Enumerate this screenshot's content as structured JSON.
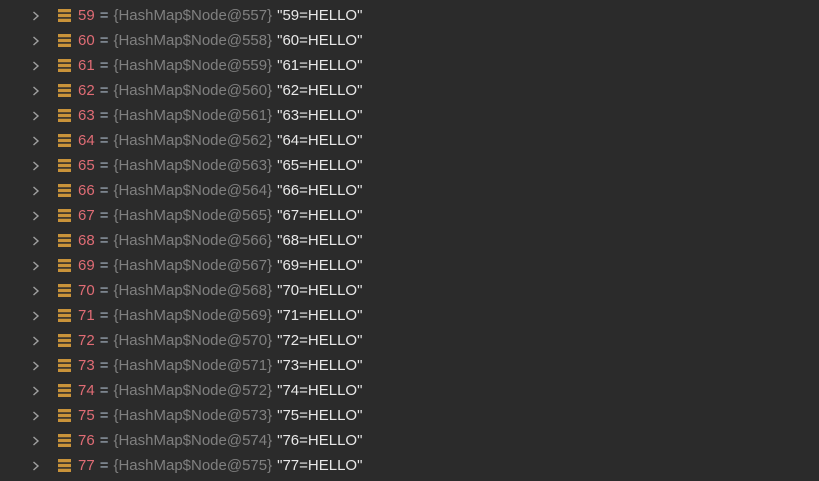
{
  "tree": {
    "equals_sign": "=",
    "icon_color": "#c9933a",
    "items": [
      {
        "key": "59",
        "type": "{HashMap$Node@557}",
        "value": "\"59=HELLO\""
      },
      {
        "key": "60",
        "type": "{HashMap$Node@558}",
        "value": "\"60=HELLO\""
      },
      {
        "key": "61",
        "type": "{HashMap$Node@559}",
        "value": "\"61=HELLO\""
      },
      {
        "key": "62",
        "type": "{HashMap$Node@560}",
        "value": "\"62=HELLO\""
      },
      {
        "key": "63",
        "type": "{HashMap$Node@561}",
        "value": "\"63=HELLO\""
      },
      {
        "key": "64",
        "type": "{HashMap$Node@562}",
        "value": "\"64=HELLO\""
      },
      {
        "key": "65",
        "type": "{HashMap$Node@563}",
        "value": "\"65=HELLO\""
      },
      {
        "key": "66",
        "type": "{HashMap$Node@564}",
        "value": "\"66=HELLO\""
      },
      {
        "key": "67",
        "type": "{HashMap$Node@565}",
        "value": "\"67=HELLO\""
      },
      {
        "key": "68",
        "type": "{HashMap$Node@566}",
        "value": "\"68=HELLO\""
      },
      {
        "key": "69",
        "type": "{HashMap$Node@567}",
        "value": "\"69=HELLO\""
      },
      {
        "key": "70",
        "type": "{HashMap$Node@568}",
        "value": "\"70=HELLO\""
      },
      {
        "key": "71",
        "type": "{HashMap$Node@569}",
        "value": "\"71=HELLO\""
      },
      {
        "key": "72",
        "type": "{HashMap$Node@570}",
        "value": "\"72=HELLO\""
      },
      {
        "key": "73",
        "type": "{HashMap$Node@571}",
        "value": "\"73=HELLO\""
      },
      {
        "key": "74",
        "type": "{HashMap$Node@572}",
        "value": "\"74=HELLO\""
      },
      {
        "key": "75",
        "type": "{HashMap$Node@573}",
        "value": "\"75=HELLO\""
      },
      {
        "key": "76",
        "type": "{HashMap$Node@574}",
        "value": "\"76=HELLO\""
      },
      {
        "key": "77",
        "type": "{HashMap$Node@575}",
        "value": "\"77=HELLO\""
      }
    ]
  }
}
